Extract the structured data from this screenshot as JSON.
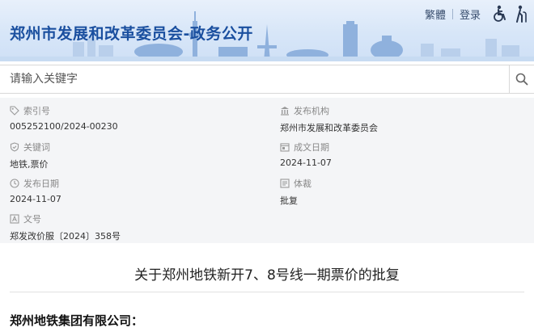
{
  "header": {
    "site_title": "郑州市发展和改革委员会-政务公开",
    "links": {
      "traditional": "繁體",
      "login": "登录"
    },
    "icons": [
      "wheelchair-icon",
      "elderly-icon"
    ]
  },
  "search": {
    "placeholder": "请输入关键字",
    "value": ""
  },
  "meta": {
    "index_no": {
      "label": "索引号",
      "value": "005252100/2024-00230"
    },
    "publisher": {
      "label": "发布机构",
      "value": "郑州市发展和改革委员会"
    },
    "keywords": {
      "label": "关键词",
      "value": "地铁,票价"
    },
    "written_date": {
      "label": "成文日期",
      "value": "2024-11-07"
    },
    "publish_date": {
      "label": "发布日期",
      "value": "2024-11-07"
    },
    "genre": {
      "label": "体裁",
      "value": "批复"
    },
    "doc_no": {
      "label": "文号",
      "value": "郑发改价服〔2024〕358号"
    }
  },
  "document": {
    "title": "关于郑州地铁新开7、8号线一期票价的批复",
    "recipient": "郑州地铁集团有限公司："
  },
  "colors": {
    "title_blue": "#1a4f9f",
    "banner_bg": "#d7e6f8",
    "meta_bg": "#f4f5f7"
  }
}
